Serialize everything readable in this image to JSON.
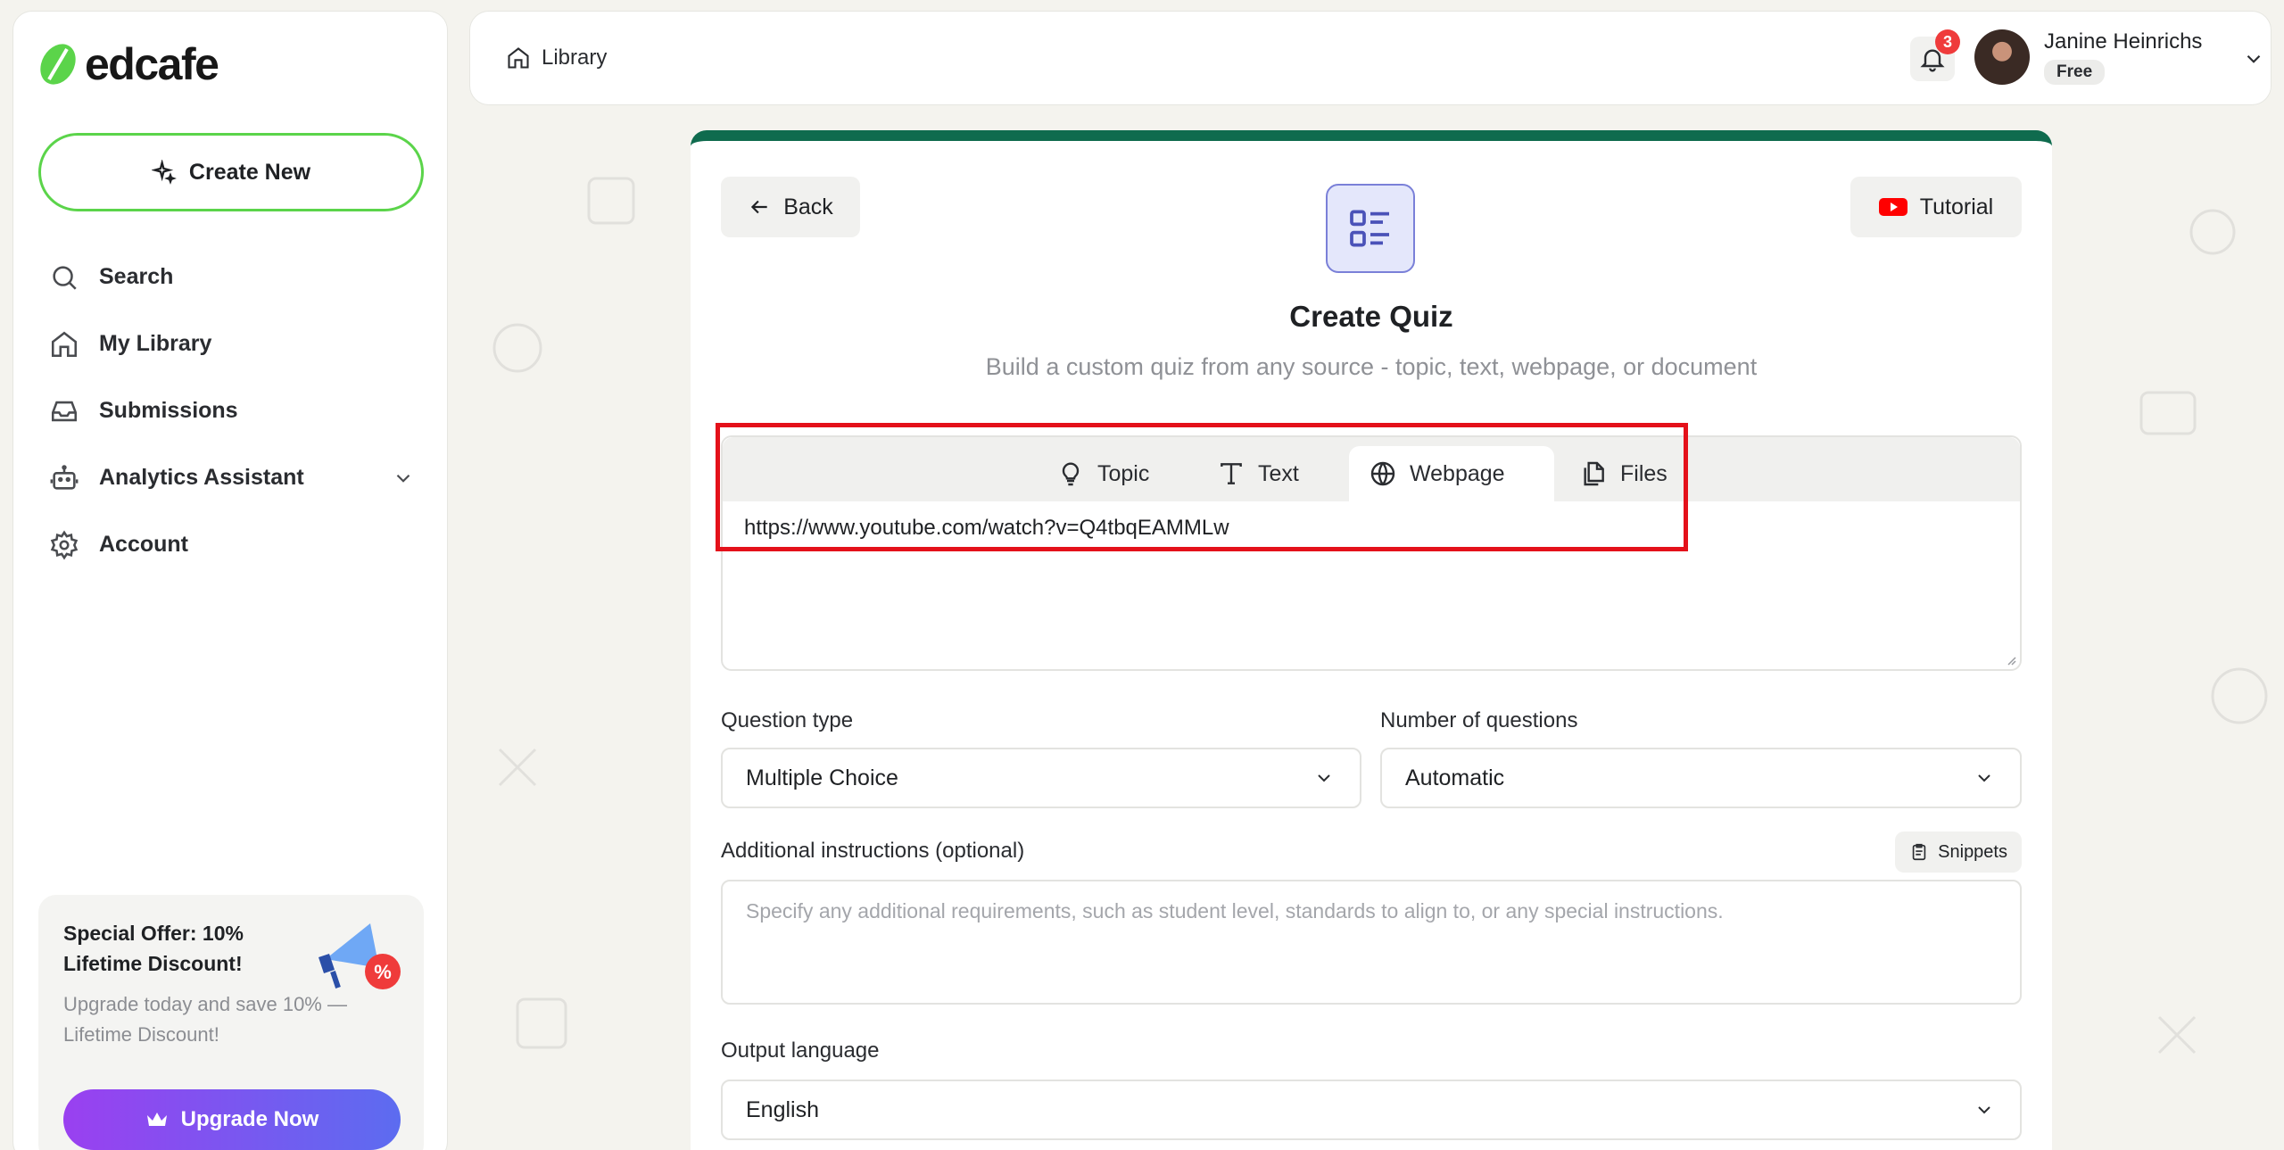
{
  "app": {
    "logo_text": "edcafe",
    "brand_color": "#5bd44a"
  },
  "sidebar": {
    "create_label": "Create New",
    "items": [
      {
        "label": "Search",
        "icon": "search-icon"
      },
      {
        "label": "My Library",
        "icon": "home-icon"
      },
      {
        "label": "Submissions",
        "icon": "inbox-icon"
      },
      {
        "label": "Analytics Assistant",
        "icon": "robot-icon"
      },
      {
        "label": "Account",
        "icon": "gear-icon"
      }
    ],
    "promo": {
      "title": "Special Offer: 10% Lifetime Discount!",
      "subtitle": "Upgrade today and save 10% — Lifetime Discount!",
      "button_label": "Upgrade Now"
    }
  },
  "header": {
    "breadcrumb": "Library",
    "notification_count": "3",
    "user_name": "Janine Heinrichs",
    "user_plan": "Free"
  },
  "main": {
    "back_label": "Back",
    "tutorial_label": "Tutorial",
    "title": "Create Quiz",
    "subtitle": "Build a custom quiz from any source - topic, text, webpage, or document",
    "source_tabs": [
      {
        "label": "Topic",
        "icon": "lightbulb-icon"
      },
      {
        "label": "Text",
        "icon": "text-icon"
      },
      {
        "label": "Webpage",
        "icon": "globe-icon",
        "active": true
      },
      {
        "label": "Files",
        "icon": "files-icon"
      }
    ],
    "url_value": "https://www.youtube.com/watch?v=Q4tbqEAMMLw",
    "question_type_label": "Question type",
    "question_type_value": "Multiple Choice",
    "num_questions_label": "Number of questions",
    "num_questions_value": "Automatic",
    "instructions_label": "Additional instructions (optional)",
    "snippets_label": "Snippets",
    "instructions_placeholder": "Specify any additional requirements, such as student level, standards to align to, or any special instructions.",
    "output_language_label": "Output language",
    "output_language_value": "English"
  },
  "colors": {
    "accent_green": "#0f6b4e",
    "highlight_red": "#e4111a",
    "upgrade_gradient_start": "#9a40f0",
    "upgrade_gradient_end": "#5c6cf0"
  }
}
